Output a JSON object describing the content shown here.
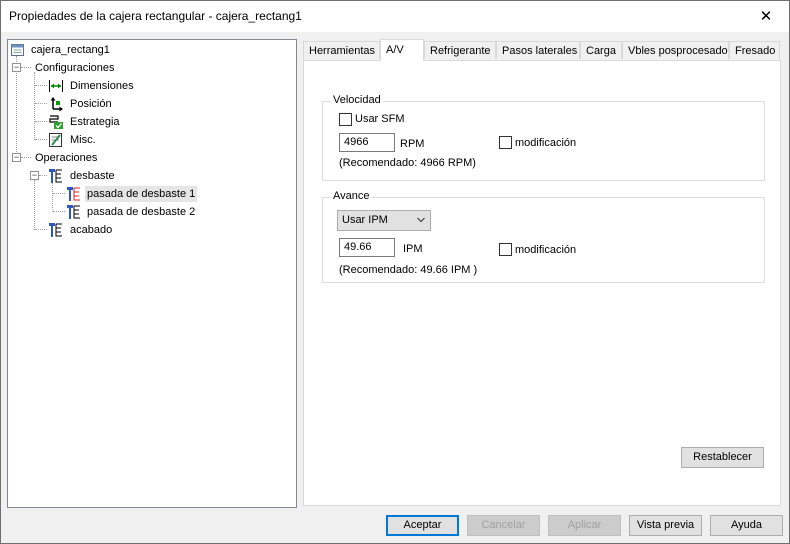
{
  "window": {
    "title": "Propiedades de la cajera rectangular - cajera_rectang1",
    "close_glyph": "✕"
  },
  "tree": {
    "root": "cajera_rectang1",
    "configuraciones": "Configuraciones",
    "dimensiones": "Dimensiones",
    "posicion": "Posición",
    "estrategia": "Estrategia",
    "misc": "Misc.",
    "operaciones": "Operaciones",
    "desbaste": "desbaste",
    "pasada1": "pasada de desbaste 1",
    "pasada2": "pasada de desbaste 2",
    "acabado": "acabado",
    "expander_minus": "−"
  },
  "tabs": [
    "Herramientas",
    "A/V",
    "Refrigerante",
    "Pasos laterales",
    "Carga",
    "Vbles posprocesado",
    "Fresado"
  ],
  "velocidad": {
    "group_title": "Velocidad",
    "usar_sfm": "Usar SFM",
    "rpm_value": "4966",
    "rpm_unit": "RPM",
    "modificacion": "modificación",
    "recomendado": "(Recomendado: 4966 RPM)"
  },
  "avance": {
    "group_title": "Avance",
    "mode_selected": "Usar IPM",
    "ipm_value": "49.66",
    "ipm_unit": "IPM",
    "modificacion": "modificación",
    "recomendado": "(Recomendado: 49.66 IPM )"
  },
  "buttons": {
    "restablecer": "Restablecer",
    "aceptar": "Aceptar",
    "cancelar": "Cancelar",
    "aplicar": "Aplicar",
    "vista_previa": "Vista previa",
    "ayuda": "Ayuda"
  },
  "colors": {
    "accent": "#0078d7",
    "selection": "#e5e5e5"
  }
}
